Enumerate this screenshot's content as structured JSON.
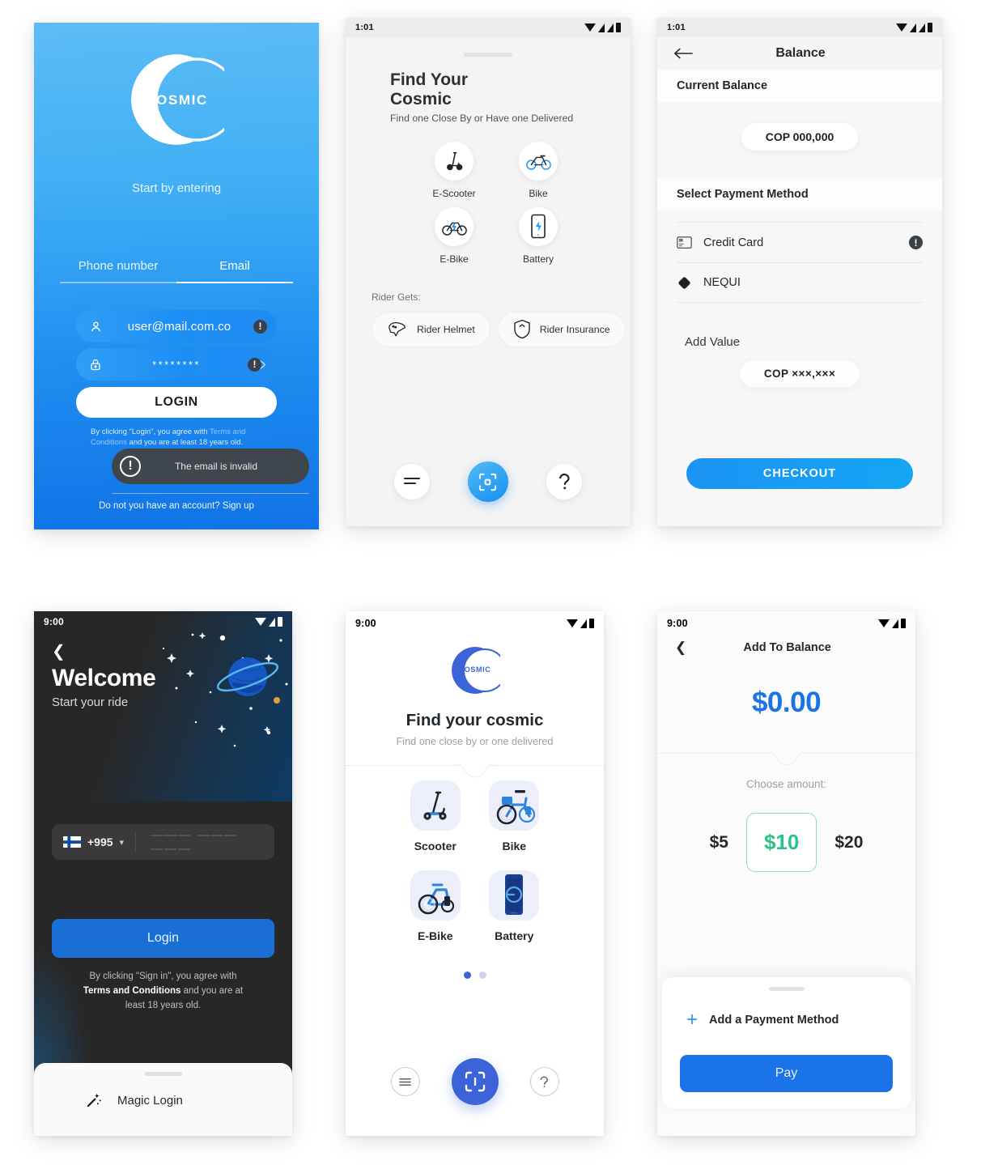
{
  "screens": {
    "login_blue": {
      "logo_text": "COSMIC",
      "start_text": "Start by entering",
      "tabs": [
        {
          "label": "Phone number",
          "active": false
        },
        {
          "label": "Email",
          "active": true
        }
      ],
      "email_field": {
        "value": "user@mail.com.co",
        "icon": "user-icon",
        "badge": "!"
      },
      "password_field": {
        "value": "********",
        "icon": "lock-icon",
        "badge": "!"
      },
      "login_label": "LOGIN",
      "terms_prefix": "By clicking \"Login\", you agree with ",
      "terms_link": "Terms and Conditions",
      "terms_suffix": " and you are at least 18 years old.",
      "error_toast": "The email is invalid",
      "signup_text": "Do not you have an account? Sign up"
    },
    "find_cosmic_1": {
      "status_time": "1:01",
      "title": "Find Your\nCosmic",
      "subtitle": "Find one Close By or Have one Delivered",
      "options": [
        {
          "label": "E-Scooter",
          "icon": "scooter-icon"
        },
        {
          "label": "Bike",
          "icon": "bike-icon"
        },
        {
          "label": "E-Bike",
          "icon": "ebike-icon"
        },
        {
          "label": "Battery",
          "icon": "battery-phone-icon"
        }
      ],
      "rider_gets_label": "Rider Gets:",
      "perks": [
        {
          "label": "Rider Helmet",
          "icon": "helmet-icon"
        },
        {
          "label": "Rider Insurance",
          "icon": "shield-icon"
        }
      ],
      "nav": [
        {
          "name": "menu-icon"
        },
        {
          "name": "scan-icon"
        },
        {
          "name": "help-icon"
        }
      ]
    },
    "balance": {
      "status_time": "1:01",
      "title": "Balance",
      "current_balance_label": "Current Balance",
      "current_balance_value": "COP 000,000",
      "select_payment_label": "Select Payment Method",
      "payment_methods": [
        {
          "label": "Credit Card",
          "icon": "credit-card-icon",
          "badge": "!"
        },
        {
          "label": "NEQUI",
          "icon": "nequi-diamond-icon",
          "badge": ""
        }
      ],
      "add_value_label": "Add Value",
      "add_value_amount": "COP ×××,×××",
      "checkout_label": "CHECKOUT"
    },
    "welcome_dark": {
      "status_time": "9:00",
      "back_icon": "chevron-left-icon",
      "title": "Welcome",
      "subtitle": "Start your ride",
      "country_code": "+995",
      "country_flag": "finland-flag-icon",
      "phone_placeholder": "——— ——— ———",
      "login_label": "Login",
      "terms_line1": "By clicking \"Sign in\", you agree with",
      "terms_bold": "Terms and Conditions",
      "terms_line2": " and you are at",
      "terms_line3": "least 18 years old.",
      "magic_login_label": "Magic Login",
      "magic_icon": "magic-wand-icon"
    },
    "find_cosmic_2": {
      "status_time": "9:00",
      "logo_text": "COSMIC",
      "title": "Find your cosmic",
      "subtitle": "Find one close by or one delivered",
      "options": [
        {
          "label": "Scooter",
          "icon": "scooter-illustration"
        },
        {
          "label": "Bike",
          "icon": "bike-illustration"
        },
        {
          "label": "E-Bike",
          "icon": "ebike-illustration"
        },
        {
          "label": "Battery",
          "icon": "battery-phone-illustration"
        }
      ],
      "page_dots": {
        "count": 2,
        "active": 0
      },
      "nav": [
        {
          "name": "menu-icon"
        },
        {
          "name": "scan-icon"
        },
        {
          "name": "help-icon"
        }
      ]
    },
    "add_to_balance": {
      "status_time": "9:00",
      "back_icon": "chevron-left-icon",
      "title": "Add To Balance",
      "amount": "$0.00",
      "choose_label": "Choose amount:",
      "amount_options": [
        {
          "label": "$5",
          "selected": false
        },
        {
          "label": "$10",
          "selected": true
        },
        {
          "label": "$20",
          "selected": false
        }
      ],
      "add_payment_label": "Add a Payment Method",
      "add_payment_icon": "plus-icon",
      "pay_label": "Pay"
    }
  },
  "colors": {
    "brand_blue": "#1b8ef5",
    "deep_blue": "#1a73e8",
    "indigo": "#3d63d8",
    "green": "#26c485",
    "dark_bg": "#272727",
    "toast_bg": "#3f464c"
  }
}
